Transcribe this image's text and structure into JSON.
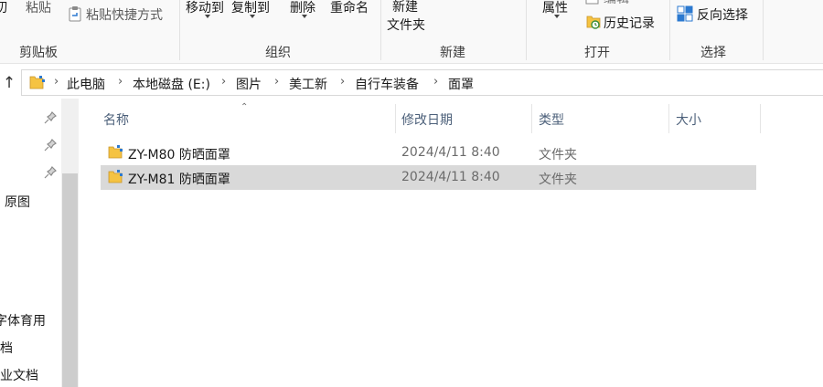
{
  "ribbon": {
    "clipboard": {
      "cut_label": "剪切",
      "paste_label": "粘贴",
      "paste_shortcut_label": "粘贴快捷方式",
      "group_label": "剪贴板"
    },
    "organize": {
      "move_to_label": "移动到",
      "copy_to_label": "复制到",
      "delete_label": "删除",
      "rename_label": "重命名",
      "group_label": "组织"
    },
    "new": {
      "new_folder_label_line1": "新建",
      "new_folder_label_line2": "文件夹",
      "group_label": "新建"
    },
    "open": {
      "properties_label": "属性",
      "edit_label": "编辑",
      "history_label": "历史记录",
      "group_label": "打开"
    },
    "select": {
      "invert_selection_label": "反向选择",
      "group_label": "选择"
    }
  },
  "address_bar": {
    "breadcrumbs": [
      "此电脑",
      "本地磁盘 (E:)",
      "图片",
      "美工新",
      "自行车装备",
      "面罩"
    ]
  },
  "nav_pane": {
    "items": [
      "原图",
      "字体育用",
      "档",
      "业文档"
    ]
  },
  "file_list": {
    "columns": [
      "名称",
      "修改日期",
      "类型",
      "大小"
    ],
    "rows": [
      {
        "name": "ZY-M80 防晒面罩",
        "modified": "2024/4/11 8:40",
        "type": "文件夹",
        "size": ""
      },
      {
        "name": "ZY-M81 防晒面罩",
        "modified": "2024/4/11 8:40",
        "type": "文件夹",
        "size": ""
      }
    ],
    "selected_index": 1
  },
  "colors": {
    "folder_yellow": "#f5c342",
    "selection": "#d9d9d9",
    "header_text": "#4c607a",
    "accent_blue": "#2b79d0"
  }
}
